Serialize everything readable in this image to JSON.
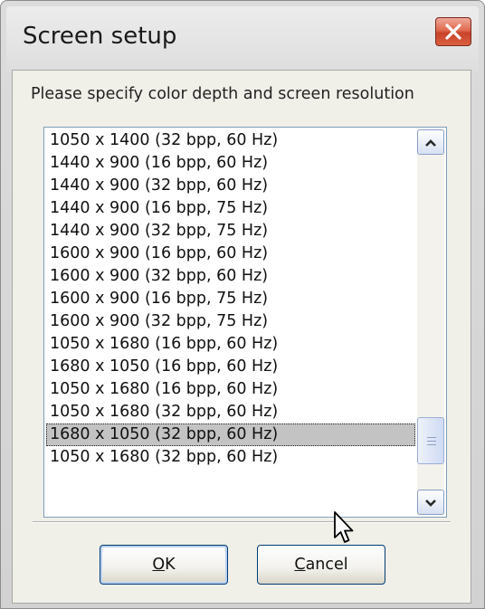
{
  "window": {
    "title": "Screen setup",
    "close_icon": "close-icon"
  },
  "prompt": "Please specify color depth and screen resolution",
  "resolutions": [
    "1050 x 1400 (32 bpp, 60 Hz)",
    "1440 x 900 (16 bpp, 60 Hz)",
    "1440 x 900 (32 bpp, 60 Hz)",
    "1440 x 900 (16 bpp, 75 Hz)",
    "1440 x 900 (32 bpp, 75 Hz)",
    "1600 x 900 (16 bpp, 60 Hz)",
    "1600 x 900 (32 bpp, 60 Hz)",
    "1600 x 900 (16 bpp, 75 Hz)",
    "1600 x 900 (32 bpp, 75 Hz)",
    "1050 x 1680 (16 bpp, 60 Hz)",
    "1680 x 1050 (16 bpp, 60 Hz)",
    "1050 x 1680 (16 bpp, 60 Hz)",
    "1050 x 1680 (32 bpp, 60 Hz)",
    "1680 x 1050 (32 bpp, 60 Hz)",
    "1050 x 1680 (32 bpp, 60 Hz)"
  ],
  "selected_index": 13,
  "buttons": {
    "ok_mnemonic": "O",
    "ok_rest": "K",
    "cancel_mnemonic": "C",
    "cancel_rest": "ancel"
  },
  "colors": {
    "selection": "#c3c3c3",
    "close_button": "#d9603f",
    "dialog_face": "#f0efe8"
  }
}
